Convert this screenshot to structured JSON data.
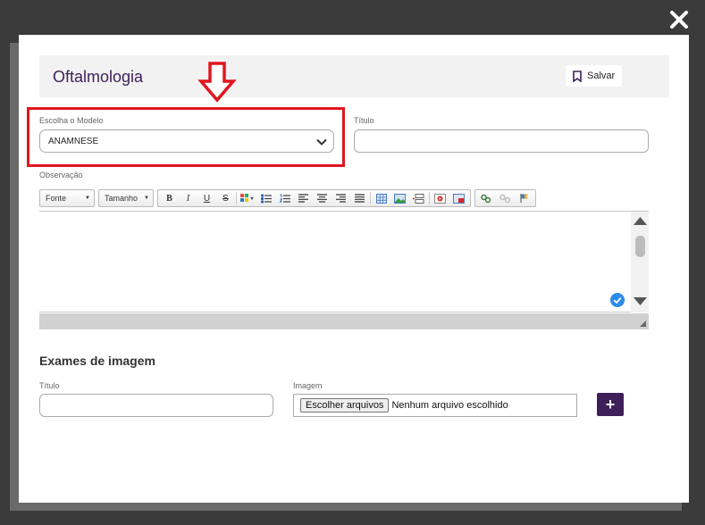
{
  "header": {
    "title": "Oftalmologia",
    "save_label": "Salvar"
  },
  "form": {
    "model_label": "Escolha o Modelo",
    "model_value": "ANAMNESE",
    "title_label": "Título",
    "observation_label": "Observação"
  },
  "toolbar": {
    "font_label": "Fonte",
    "size_label": "Tamanho"
  },
  "exams": {
    "section_title": "Exames de imagem",
    "title_label": "Título",
    "image_label": "Imagem",
    "file_button": "Escolher arquivos",
    "file_status": "Nenhum arquivo escolhido",
    "add_symbol": "+"
  },
  "colors": {
    "brand": "#3e1f5a",
    "annotation": "#e0161f",
    "check": "#2d8ceb"
  },
  "icons": [
    "close-icon",
    "bookmark-icon",
    "chevron-down-icon",
    "down-arrow-icon",
    "check-circle-icon"
  ]
}
